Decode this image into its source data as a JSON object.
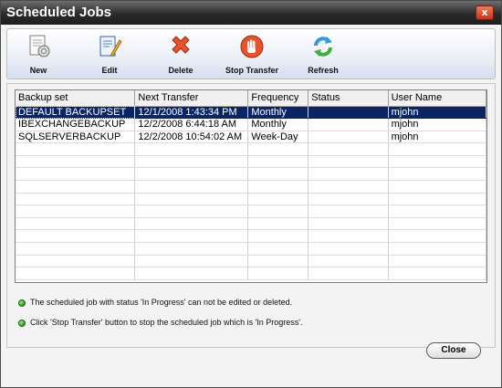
{
  "window": {
    "title": "Scheduled Jobs",
    "close_glyph": "x"
  },
  "toolbar": {
    "new_label": "New",
    "edit_label": "Edit",
    "delete_label": "Delete",
    "stop_label": "Stop Transfer",
    "refresh_label": "Refresh",
    "icons": [
      "new-job-icon",
      "edit-icon",
      "delete-icon",
      "stop-transfer-icon",
      "refresh-icon"
    ]
  },
  "table": {
    "columns": [
      "Backup set",
      "Next Transfer",
      "Frequency",
      "Status",
      "User Name"
    ],
    "rows": [
      [
        "DEFAULT BACKUPSET",
        "12/1/2008 1:43:34 PM",
        "Monthly",
        "",
        "mjohn"
      ],
      [
        "IBEXCHANGEBACKUP",
        "12/2/2008 6:44:18 AM",
        "Monthly",
        "",
        "mjohn"
      ],
      [
        "SQLSERVERBACKUP",
        "12/2/2008 10:54:02 AM",
        "Week-Day",
        "",
        "mjohn"
      ]
    ],
    "selected_row": 0
  },
  "notes": {
    "note1": "The scheduled job with status 'In Progress' can not be edited or deleted.",
    "note2": "Click 'Stop Transfer' button to stop the scheduled job which is 'In Progress'."
  },
  "footer": {
    "close_label": "Close"
  },
  "colors": {
    "selection": "#0a2466",
    "titlebar": "#2b2b2b",
    "bullet": "#2f9a1f"
  }
}
